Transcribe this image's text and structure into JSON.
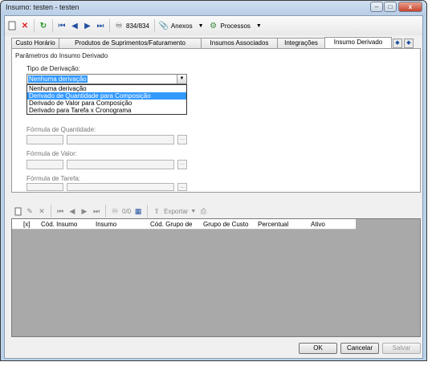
{
  "window": {
    "title": "Insumo: testen - testen"
  },
  "toolbar": {
    "record_counter": "834/834",
    "attachments_label": "Anexos",
    "processes_label": "Processos"
  },
  "tabs": [
    {
      "label": "Custo Horário"
    },
    {
      "label": "Produtos de Suprimentos/Faturamento"
    },
    {
      "label": "Insumos Associados"
    },
    {
      "label": "Integrações"
    },
    {
      "label": "Insumo Derivado"
    }
  ],
  "panel": {
    "group_title": "Parâmetros do Insumo Derivado",
    "derivation_label": "Tipo de Derivação:",
    "derivation_value": "Nenhuma derivação",
    "derivation_options": [
      "Nenhuma derivação",
      "Derivado de Quantidade para Composição",
      "Derivado de Valor para Composição",
      "Derivado para Tarefa x Cronograma"
    ],
    "quantity_formula_label": "Fórmula de Quantidade:",
    "value_formula_label": "Fórmula de Valor:",
    "task_formula_label": "Fórmula de Tarefa:"
  },
  "grid_toolbar": {
    "counter": "0/0",
    "export_label": "Exportar"
  },
  "grid": {
    "columns": [
      "[x]",
      "Cód. Insumo",
      "Insumo",
      "Cód. Grupo de",
      "Grupo de Custo",
      "Percentual",
      "Ativo"
    ]
  },
  "buttons": {
    "ok": "OK",
    "cancel": "Cancelar",
    "save": "Salvar"
  },
  "colors": {
    "accent": "#3399ff",
    "grid_bg": "#a9a9a9",
    "frame": "#b9d1ea"
  }
}
